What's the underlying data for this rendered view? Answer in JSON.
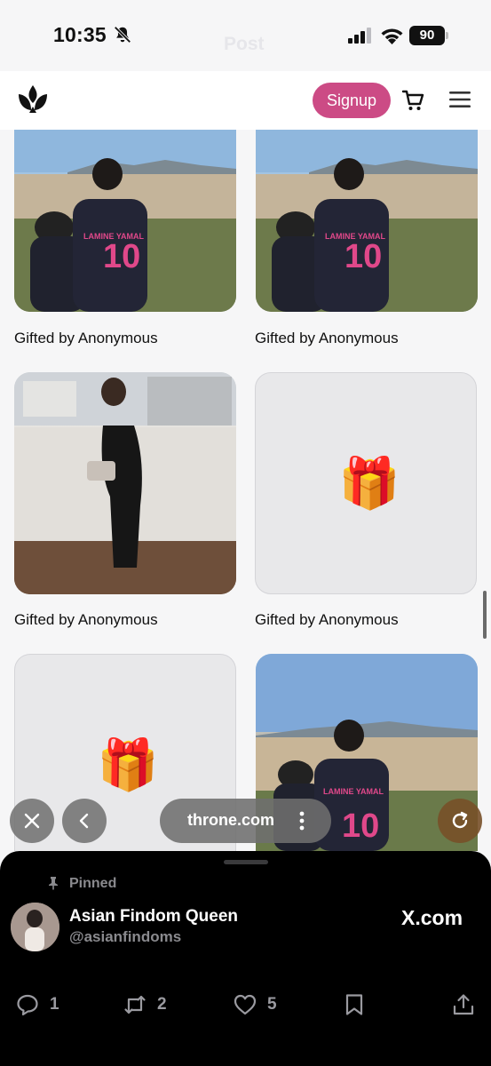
{
  "status_bar": {
    "time": "10:35",
    "faded_title": "Post",
    "battery": "90"
  },
  "header": {
    "signup_label": "Signup"
  },
  "cards": [
    {
      "caption": "Gifted by Anonymous",
      "jersey": "10",
      "jersey_name": "LAMINE YAMAL"
    },
    {
      "caption": "Gifted by Anonymous",
      "jersey": "10",
      "jersey_name": "LAMINE YAMAL"
    },
    {
      "caption": "Gifted by Anonymous"
    },
    {
      "caption": "Gifted by Anonymous",
      "gift": "🎁"
    },
    {
      "gift": "🎁"
    },
    {
      "jersey": "10",
      "jersey_name": "LAMINE YAMAL"
    }
  ],
  "browser": {
    "url": "throne.com"
  },
  "post": {
    "pinned_label": "Pinned",
    "account_name": "Asian Findom Queen",
    "account_handle": "@asianfindoms",
    "source": "X.com",
    "replies": "1",
    "reposts": "2",
    "likes": "5"
  },
  "colors": {
    "signup": "#cc4b85",
    "sheet_bg": "#000000",
    "page_bg": "#f6f6f7"
  },
  "icons": [
    "bell-slash-icon",
    "signal-icon",
    "wifi-icon",
    "battery-icon",
    "crown-logo-icon",
    "cart-icon",
    "menu-icon",
    "gift-icon",
    "close-icon",
    "back-icon",
    "more-icon",
    "reload-icon",
    "pin-icon",
    "reply-icon",
    "repost-icon",
    "like-icon",
    "bookmark-icon",
    "share-icon"
  ]
}
